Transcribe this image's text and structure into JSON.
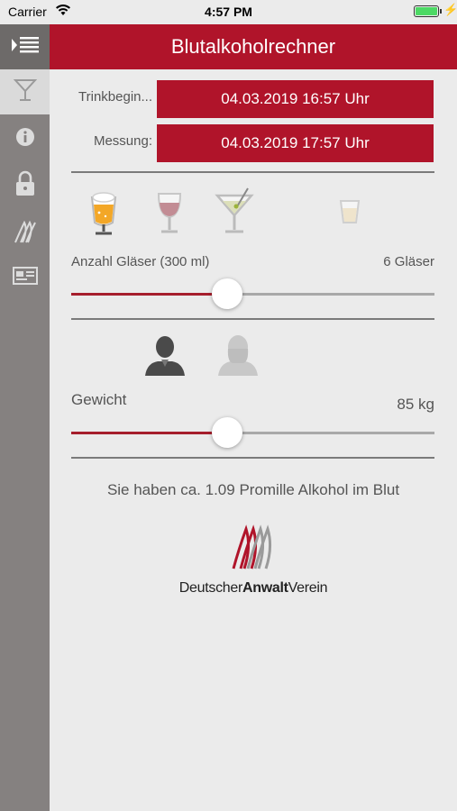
{
  "status": {
    "carrier": "Carrier",
    "time": "4:57 PM"
  },
  "header": {
    "title": "Blutalkoholrechner"
  },
  "sidebar": {
    "items": [
      {
        "icon": "menu-icon"
      },
      {
        "icon": "cocktail-glass-icon",
        "active": true
      },
      {
        "icon": "info-icon"
      },
      {
        "icon": "lock-icon"
      },
      {
        "icon": "dav-logo-icon"
      },
      {
        "icon": "contact-card-icon"
      }
    ]
  },
  "times": {
    "start_label": "Trinkbegin...",
    "start_value": "04.03.2019 16:57 Uhr",
    "measure_label": "Messung:",
    "measure_value": "04.03.2019 17:57 Uhr"
  },
  "drinks": {
    "options": [
      "beer",
      "wine",
      "cocktail",
      "shot"
    ],
    "selected": "beer",
    "label": "Anzahl Gläser (300 ml)",
    "value_text": "6 Gläser",
    "slider_fraction": 0.43
  },
  "person": {
    "options": [
      "male",
      "female"
    ],
    "selected": "male",
    "label": "Gewicht",
    "value_text": "85 kg",
    "slider_fraction": 0.43
  },
  "result": {
    "text": "Sie haben ca. 1.09 Promille Alkohol im Blut"
  },
  "logo": {
    "part1": "Deutscher",
    "part2": "Anwalt",
    "part3": "Verein"
  },
  "colors": {
    "brand_red": "#b0142a",
    "sidebar": "#858180",
    "background": "#ebebeb"
  }
}
